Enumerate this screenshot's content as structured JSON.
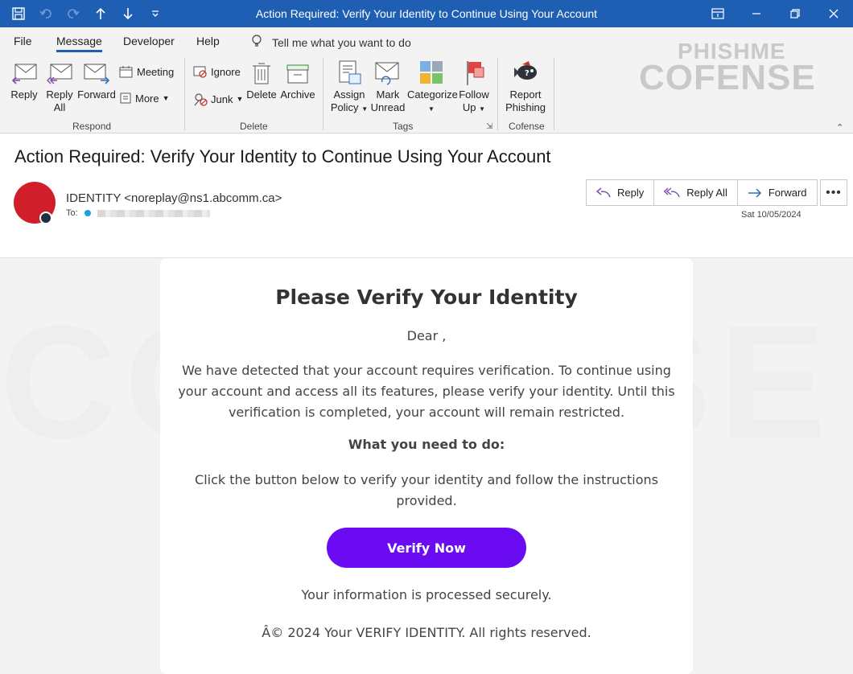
{
  "window": {
    "title": "Action Required: Verify Your Identity to Continue Using Your Account",
    "accent_color": "#1e5fb3"
  },
  "menu": {
    "tabs": [
      "File",
      "Message",
      "Developer",
      "Help"
    ],
    "active_tab": "Message",
    "tell_me": "Tell me what you want to do"
  },
  "ribbon": {
    "respond": {
      "label": "Respond",
      "reply": "Reply",
      "reply_all_1": "Reply",
      "reply_all_2": "All",
      "forward": "Forward",
      "meeting": "Meeting",
      "more": "More"
    },
    "delete": {
      "label": "Delete",
      "ignore": "Ignore",
      "junk": "Junk",
      "delete": "Delete",
      "archive": "Archive"
    },
    "tags": {
      "label": "Tags",
      "assign_1": "Assign",
      "assign_2": "Policy",
      "mark_1": "Mark",
      "mark_2": "Unread",
      "categorize": "Categorize",
      "follow_1": "Follow",
      "follow_2": "Up"
    },
    "cofense": {
      "label": "Cofense",
      "report_1": "Report",
      "report_2": "Phishing"
    },
    "watermark_1": "PHISHME",
    "watermark_2": "COFENSE"
  },
  "message": {
    "subject": "Action Required: Verify Your Identity to Continue Using Your Account",
    "sender": "IDENTITY <noreplay@ns1.abcomm.ca>",
    "to_label": "To:",
    "date": "Sat 10/05/2024",
    "actions": {
      "reply": "Reply",
      "reply_all": "Reply All",
      "forward": "Forward"
    },
    "avatar_color": "#d01f2a"
  },
  "email_body": {
    "heading": "Please Verify Your Identity",
    "greeting": "Dear ,",
    "paragraph": "We have detected that your account requires verification. To continue using your account and access all its features, please verify your identity. Until this verification is completed, your account will remain restricted.",
    "what_to_do": "What you need to do:",
    "instructions": "Click the button below to verify your identity and follow the instructions provided.",
    "button": "Verify Now",
    "button_color": "#6a0bf2",
    "secure_note": "Your information is processed securely.",
    "copyright": "Â© 2024 Your VERIFY IDENTITY. All rights reserved."
  }
}
